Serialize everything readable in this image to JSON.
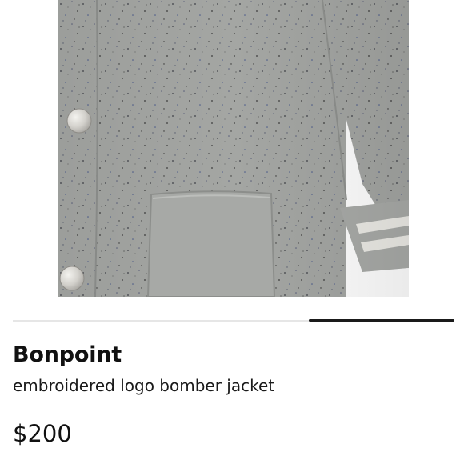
{
  "listing": {
    "image_alt": "grey speckled knit bomber jacket with snap buttons and front pocket",
    "brand": "Bonpoint",
    "title": "embroidered logo bomber jacket",
    "price": "$200"
  },
  "carousel": {
    "position_fraction_start": 0.67,
    "position_fraction_end": 1.0
  },
  "colors": {
    "knit": "#a4a6a3",
    "cuff_stripe": "#ecebe6",
    "snap": "#d6d4cf",
    "indicator_active": "#1a1a1a",
    "indicator_track": "#e6e6e6"
  }
}
